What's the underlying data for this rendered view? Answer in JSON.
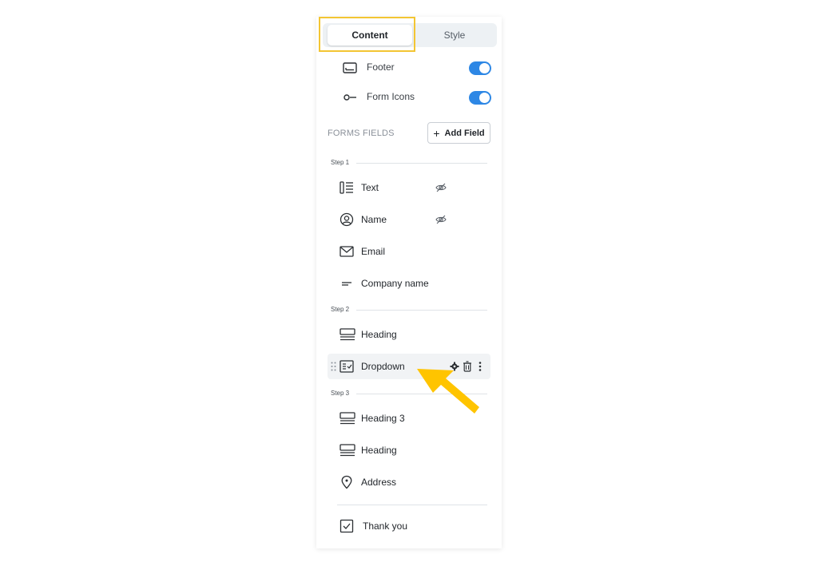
{
  "tabs": {
    "content": "Content",
    "style": "Style"
  },
  "toggles": [
    {
      "label": "Footer",
      "icon": "footer-icon",
      "on": true
    },
    {
      "label": "Form Icons",
      "icon": "form-icons-icon",
      "on": true
    }
  ],
  "forms_fields": {
    "label": "FORMS FIELDS",
    "add_button": "Add Field"
  },
  "steps": [
    {
      "label": "Step 1",
      "fields": [
        {
          "label": "Text",
          "icon": "text-field-icon",
          "hidden": true
        },
        {
          "label": "Name",
          "icon": "user-icon",
          "hidden": true
        },
        {
          "label": "Email",
          "icon": "mail-icon",
          "hidden": false
        },
        {
          "label": "Company name",
          "icon": "short-text-icon",
          "hidden": false
        }
      ]
    },
    {
      "label": "Step 2",
      "fields": [
        {
          "label": "Heading",
          "icon": "heading-icon",
          "hidden": false
        },
        {
          "label": "Dropdown",
          "icon": "dropdown-icon",
          "hidden": false,
          "selected": true
        }
      ]
    },
    {
      "label": "Step 3",
      "fields": [
        {
          "label": "Heading 3",
          "icon": "heading-icon",
          "hidden": false
        },
        {
          "label": "Heading",
          "icon": "heading-icon",
          "hidden": false
        },
        {
          "label": "Address",
          "icon": "map-pin-icon",
          "hidden": false
        }
      ]
    }
  ],
  "thank_you": {
    "label": "Thank you",
    "icon": "checkbox-icon"
  },
  "colors": {
    "accent": "#2d87e5",
    "highlight": "#f3c533",
    "arrow": "#ffc400"
  }
}
